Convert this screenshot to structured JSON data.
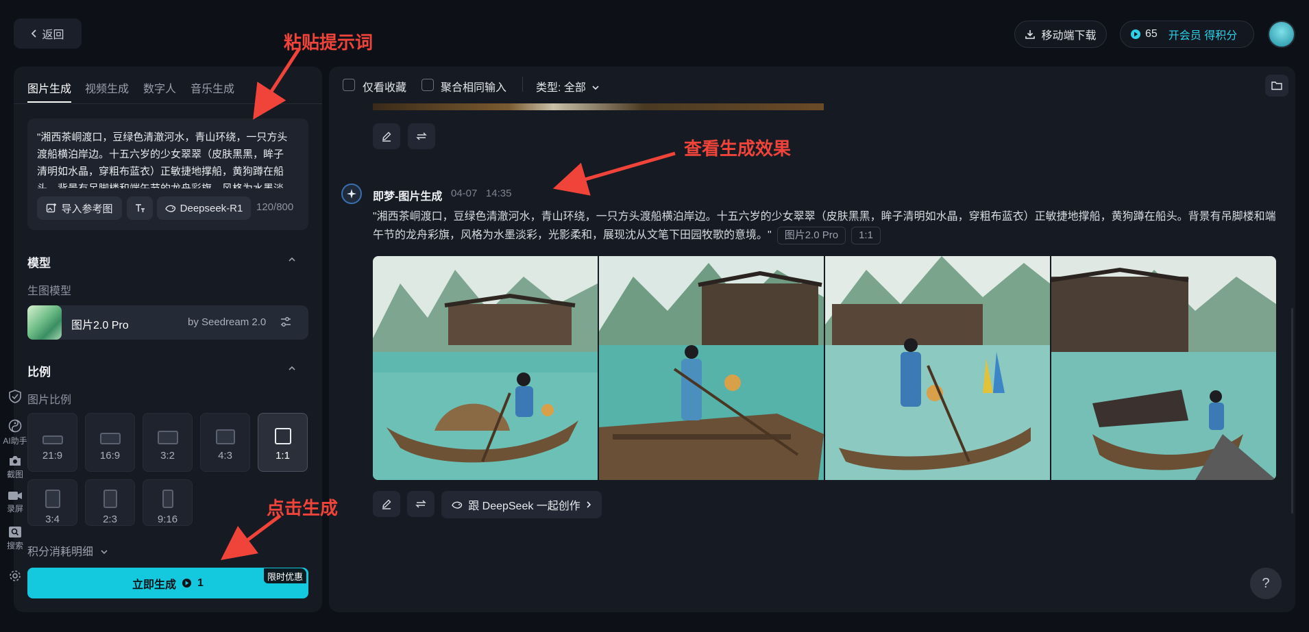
{
  "header": {
    "back_label": "返回",
    "download_label": "移动端下载",
    "credits": "65",
    "vip_label": "开会员 得积分"
  },
  "left_panel": {
    "tabs": [
      "图片生成",
      "视频生成",
      "数字人",
      "音乐生成"
    ],
    "prompt_text": "\"湘西茶峒渡口，豆绿色清澈河水，青山环绕，一只方头渡船横泊岸边。十五六岁的少女翠翠（皮肤黑黑，眸子清明如水晶，穿粗布蓝衣）正敏捷地撑船，黄狗蹲在船头。背景有吊脚楼和端午节的龙舟彩旗，风格为水墨淡彩，光影柔和，展现沈从文笔下田园牧歌的意境。\"",
    "ref_image_label": "导入参考图",
    "deepseek_pill": "Deepseek-R1",
    "char_count": "120/800",
    "model_section": {
      "title": "模型",
      "subtitle": "生图模型",
      "model_name": "图片2.0 Pro",
      "model_by": "by Seedream 2.0"
    },
    "ratio_section": {
      "title": "比例",
      "subtitle": "图片比例",
      "ratios": [
        "21:9",
        "16:9",
        "3:2",
        "4:3",
        "1:1",
        "3:4",
        "2:3",
        "9:16"
      ],
      "selected": "1:1"
    },
    "side_tools": [
      "AI助手",
      "截图",
      "录屏",
      "搜索"
    ],
    "points_detail": "积分消耗明细",
    "generate_label": "立即生成",
    "generate_cost": "1",
    "promo_badge": "限时优惠"
  },
  "right_panel": {
    "filter_fav": "仅看收藏",
    "filter_merge": "聚合相同输入",
    "type_filter": "类型: 全部",
    "bot_name": "即梦-图片生成",
    "bot_date": "04-07",
    "bot_time": "14:35",
    "gen_prompt": "\"湘西茶峒渡口，豆绿色清澈河水，青山环绕，一只方头渡船横泊岸边。十五六岁的少女翠翠（皮肤黑黑，眸子清明如水晶，穿粗布蓝衣）正敏捷地撑船，黄狗蹲在船头。背景有吊脚楼和端午节的龙舟彩旗，风格为水墨淡彩，光影柔和，展现沈从文笔下田园牧歌的意境。\"",
    "gen_tag_model": "图片2.0 Pro",
    "gen_tag_ratio": "1:1",
    "deepseek_create": "跟 DeepSeek 一起创作"
  },
  "annotations": {
    "paste_prompt": "粘贴提示词",
    "view_result": "查看生成效果",
    "click_generate": "点击生成"
  },
  "colors": {
    "accent": "#14c8de",
    "annotation": "#f0443a",
    "panel": "#161a23",
    "background": "#0d1017"
  }
}
